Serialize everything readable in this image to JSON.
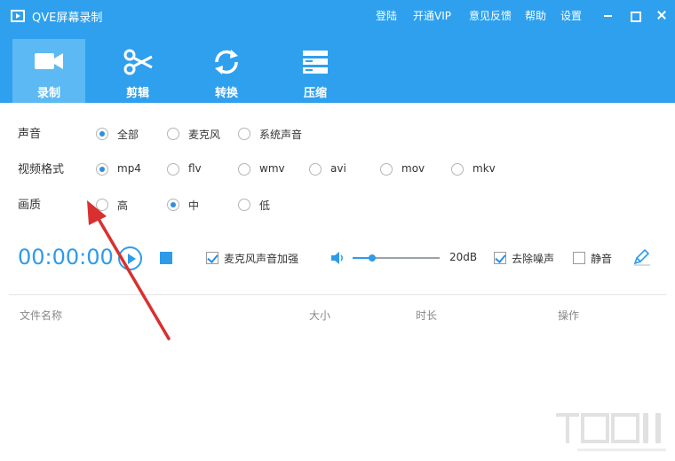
{
  "window": {
    "title": "QVE屏幕录制",
    "links": [
      "登陆",
      "开通VIP",
      "意见反馈",
      "帮助",
      "设置"
    ]
  },
  "tabs": [
    {
      "label": "录制",
      "icon": "video-camera-icon",
      "active": true
    },
    {
      "label": "剪辑",
      "icon": "scissors-icon",
      "active": false
    },
    {
      "label": "转换",
      "icon": "refresh-icon",
      "active": false
    },
    {
      "label": "压缩",
      "icon": "compress-icon",
      "active": false
    }
  ],
  "settings": {
    "audio": {
      "label": "声音",
      "options": [
        "全部",
        "麦克风",
        "系统声音"
      ],
      "selected": "全部"
    },
    "format": {
      "label": "视频格式",
      "options": [
        "mp4",
        "flv",
        "wmv",
        "avi",
        "mov",
        "mkv"
      ],
      "selected": "mp4"
    },
    "quality": {
      "label": "画质",
      "options": [
        "高",
        "中",
        "低"
      ],
      "selected": "中"
    }
  },
  "controls": {
    "timer": "00:00:00",
    "mic_boost": {
      "label": "麦克风声音加强",
      "checked": true
    },
    "volume": {
      "value": 0.22,
      "display": "20dB"
    },
    "denoise": {
      "label": "去除噪声",
      "checked": true
    },
    "mute": {
      "label": "静音",
      "checked": false
    }
  },
  "table": {
    "columns": [
      "文件名称",
      "大小",
      "时长",
      "操作"
    ]
  },
  "colors": {
    "header": "#2ea0ee",
    "active_tab": "#5cb9f3",
    "accent": "#2e9bea",
    "arrow": "#d9302f"
  }
}
